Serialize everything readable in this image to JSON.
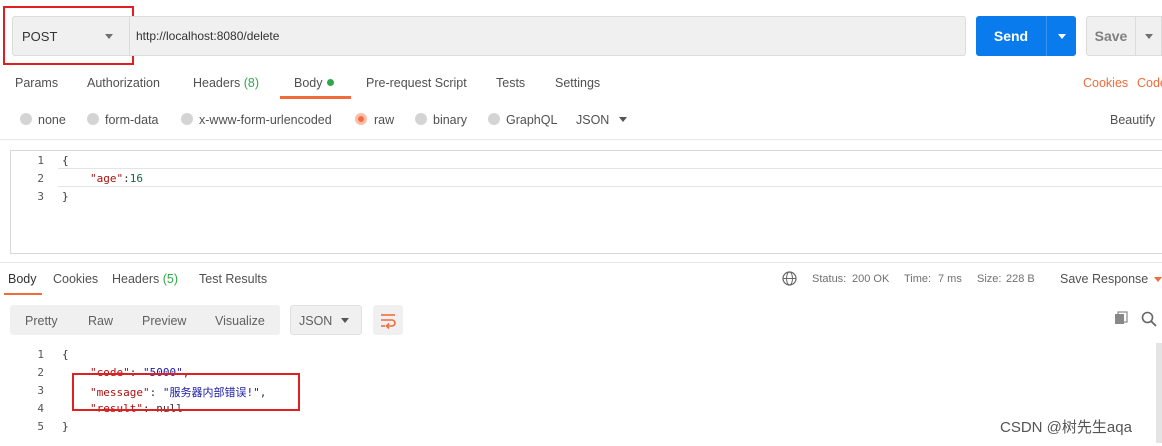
{
  "request": {
    "method": "POST",
    "url": "http://localhost:8080/delete",
    "send_label": "Send",
    "save_label": "Save"
  },
  "request_tabs": [
    "Params",
    "Authorization",
    "Headers",
    "(8)",
    "Body",
    "Pre-request Script",
    "Tests",
    "Settings"
  ],
  "request_links": {
    "cookies": "Cookies",
    "code": "Code",
    "beautify": "Beautify"
  },
  "body_types": {
    "options": [
      "none",
      "form-data",
      "x-www-form-urlencoded",
      "raw",
      "binary",
      "GraphQL"
    ],
    "selected": "raw",
    "format": "JSON"
  },
  "request_body": {
    "line_numbers": [
      "1",
      "2",
      "3"
    ],
    "open_brace": "{",
    "key": "\"age\"",
    "colon": ":",
    "value": "16",
    "close_brace": "}"
  },
  "response": {
    "tabs": [
      "Body",
      "Cookies",
      "Headers",
      "(5)",
      "Test Results"
    ],
    "status_label": "Status:",
    "status_value": "200 OK",
    "time_label": "Time:",
    "time_value": "7 ms",
    "size_label": "Size:",
    "size_value": "228 B",
    "save_response": "Save Response",
    "view_modes": [
      "Pretty",
      "Raw",
      "Preview",
      "Visualize"
    ],
    "format": "JSON",
    "line_numbers": [
      "1",
      "2",
      "3",
      "4",
      "5"
    ],
    "open_brace": "{",
    "code_key": "\"code\"",
    "code_value": "\"5000\"",
    "message_key": "\"message\"",
    "message_value": "\"服务器内部错误!\"",
    "result_key": "\"result\"",
    "result_value": "null",
    "close_brace": "}"
  },
  "watermark": "CSDN @树先生aqa",
  "colors": {
    "accent": "#f26b3a",
    "send": "#097bed",
    "status_ok": "#31a74a",
    "highlight_box": "#e02020"
  }
}
